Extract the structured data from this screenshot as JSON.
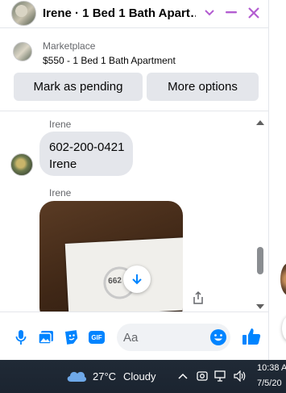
{
  "window": {
    "title": "Irene · 1 Bed 1 Bath Apart…",
    "accent_color": "#b35cd1",
    "controls": [
      "chevron-down-icon",
      "minimize-icon",
      "close-icon"
    ]
  },
  "marketplace": {
    "label": "Marketplace",
    "listing": "$550 - 1 Bed 1 Bath Apartment",
    "buttons": {
      "pending": "Mark as pending",
      "more": "More options"
    }
  },
  "messages": [
    {
      "sender": "Irene",
      "lines": [
        "602-200-0421",
        "Irene"
      ]
    },
    {
      "sender": "Irene",
      "type": "photo"
    }
  ],
  "photo_text": {
    "score": "662"
  },
  "composer": {
    "placeholder": "Aa",
    "gif_label": "GIF",
    "icons": [
      "microphone-icon",
      "gallery-icon",
      "sticker-icon",
      "gif-icon",
      "emoji-icon",
      "thumbs-up-icon"
    ],
    "accent_color": "#0084ff"
  },
  "taskbar": {
    "temperature": "27°C",
    "weather": "Cloudy",
    "time": "10:38 A",
    "date": "7/5/20"
  }
}
